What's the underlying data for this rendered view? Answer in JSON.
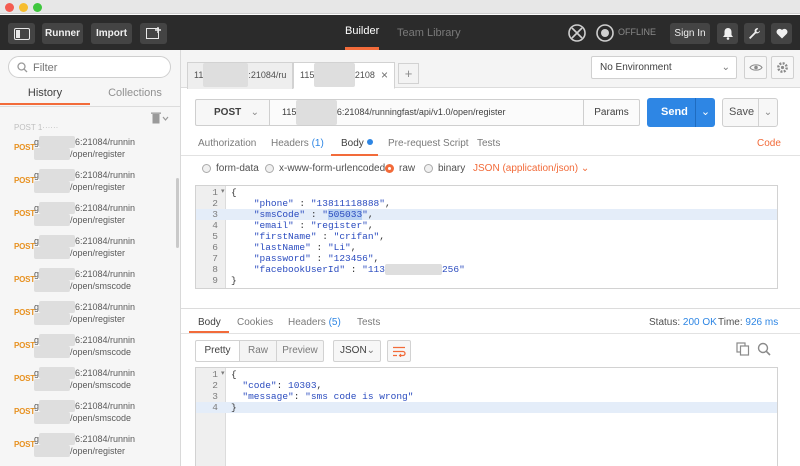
{
  "topbar": {
    "runner_label": "Runner",
    "import_label": "Import",
    "builder_tab": "Builder",
    "team_library_tab": "Team Library",
    "offline_label": "OFFLINE",
    "sign_in_label": "Sign In"
  },
  "sidebar": {
    "filter_placeholder": "Filter",
    "tabs": [
      "History",
      "Collections"
    ],
    "history": [
      {
        "method": "POST",
        "host": "g",
        "port_path": "6:21084/runnin",
        "path2": "/open/register"
      },
      {
        "method": "POST",
        "host": "g",
        "port_path": "6:21084/runnin",
        "path2": "/open/register"
      },
      {
        "method": "POST",
        "host": "g",
        "port_path": "6:21084/runnin",
        "path2": "/open/register"
      },
      {
        "method": "POST",
        "host": "g",
        "port_path": "6:21084/runnin",
        "path2": "/open/register"
      },
      {
        "method": "POST",
        "host": "g",
        "port_path": "6:21084/runnin",
        "path2": "/open/smscode"
      },
      {
        "method": "POST",
        "host": "g",
        "port_path": "6:21084/runnin",
        "path2": "/open/register"
      },
      {
        "method": "POST",
        "host": "g",
        "port_path": "6:21084/runnin",
        "path2": "/open/smscode"
      },
      {
        "method": "POST",
        "host": "g",
        "port_path": "6:21084/runnin",
        "path2": "/open/smscode"
      },
      {
        "method": "POST",
        "host": "g",
        "port_path": "6:21084/runnin",
        "path2": "/open/smscode"
      },
      {
        "method": "POST",
        "host": "g",
        "port_path": "6:21084/runnin",
        "path2": "/open/register"
      }
    ]
  },
  "tabs": {
    "tab1": {
      "prefix": "11",
      "suffix": ":21084/ru"
    },
    "tab2": {
      "prefix": "115",
      "suffix": "2108"
    },
    "close_symbol": "×",
    "add_symbol": "+"
  },
  "environment": {
    "selected": "No Environment"
  },
  "request": {
    "method": "POST",
    "url_prefix": "115",
    "url_rest": "6:21084/runningfast/api/v1.0/open/register",
    "params_label": "Params",
    "send_label": "Send",
    "save_label": "Save"
  },
  "request_tabs": {
    "authorization": "Authorization",
    "headers": "Headers",
    "headers_count": "(1)",
    "body": "Body",
    "prerequest": "Pre-request Script",
    "tests": "Tests",
    "code": "Code"
  },
  "body_modes": {
    "form_data": "form-data",
    "urlencoded": "x-www-form-urlencoded",
    "raw": "raw",
    "binary": "binary",
    "content_type": "JSON (application/json)"
  },
  "request_body": {
    "line1": "{",
    "phone_key": "\"phone\"",
    "phone_val": "\"13811118888\"",
    "sms_key": "\"smsCode\"",
    "sms_q1": "\"",
    "sms_val": "505033",
    "sms_q2": "\"",
    "email_key": "\"email\"",
    "email_val": "\"register\"",
    "first_key": "\"firstName\"",
    "first_val": "\"crifan\"",
    "last_key": "\"lastName\"",
    "last_val": "\"Li\"",
    "pwd_key": "\"password\"",
    "pwd_val": "\"123456\"",
    "fb_key": "\"facebookUserId\"",
    "fb_val_prefix": "\"113",
    "fb_val_suffix": "256\"",
    "line9": "}"
  },
  "response_tabs": {
    "body": "Body",
    "cookies": "Cookies",
    "headers": "Headers",
    "headers_count": "(5)",
    "tests": "Tests",
    "status_label": "Status:",
    "status_value": "200 OK",
    "time_label": "Time:",
    "time_value": "926 ms"
  },
  "response_view": {
    "pretty": "Pretty",
    "raw": "Raw",
    "preview": "Preview",
    "format": "JSON"
  },
  "response_body": {
    "line1": "{",
    "code_key": "\"code\"",
    "code_val": "10303",
    "message_key": "\"message\"",
    "message_val": "\"sms code is wrong\"",
    "line4": "}"
  },
  "colors": {
    "accent": "#f26b3a",
    "send_blue": "#2e86e4",
    "post_orange": "#e79120",
    "topbar_bg": "#2b2b2b"
  }
}
